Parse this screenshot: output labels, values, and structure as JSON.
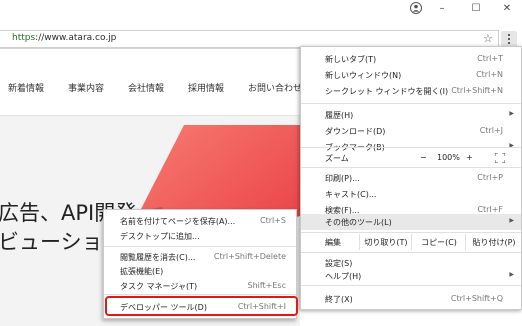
{
  "window": {
    "minimize_icon": "minimize-icon",
    "maximize_icon": "maximize-icon",
    "close_icon": "close-icon"
  },
  "omnibox": {
    "scheme": "https",
    "rest": "://www.atara.co.jp"
  },
  "site": {
    "nav": [
      "新着情報",
      "事業内容",
      "会社情報",
      "採用情報",
      "お問い合わせ"
    ],
    "hero_line1": "広告、API開発",
    "hero_line2": "ビューション",
    "accent_color": "#f2585a"
  },
  "menu": {
    "items": [
      {
        "label": "新しいタブ(T)",
        "shortcut": "Ctrl+T"
      },
      {
        "label": "新しいウィンドウ(N)",
        "shortcut": "Ctrl+N"
      },
      {
        "label": "シークレット ウィンドウを開く(I)",
        "shortcut": "Ctrl+Shift+N"
      },
      {
        "label": "履歴(H)",
        "submenu": true
      },
      {
        "label": "ダウンロード(D)",
        "shortcut": "Ctrl+J"
      },
      {
        "label": "ブックマーク(B)",
        "submenu": true
      },
      {
        "label": "印刷(P)...",
        "shortcut": "Ctrl+P"
      },
      {
        "label": "キャスト(C)..."
      },
      {
        "label": "検索(F)...",
        "shortcut": "Ctrl+F"
      },
      {
        "label": "その他のツール(L)",
        "submenu": true
      },
      {
        "label": "設定(S)"
      },
      {
        "label": "ヘルプ(H)",
        "submenu": true
      },
      {
        "label": "終了(X)",
        "shortcut": "Ctrl+Shift+Q"
      }
    ],
    "zoom": {
      "label": "ズーム",
      "minus": "−",
      "value": "100%",
      "plus": "+",
      "fullscreen_icon": "fullscreen-icon"
    },
    "edit": {
      "label": "編集",
      "cut": "切り取り(T)",
      "copy": "コピー(C)",
      "paste": "貼り付け(P)"
    }
  },
  "submenu": {
    "items": [
      {
        "label": "名前を付けてページを保存(A)...",
        "shortcut": "Ctrl+S"
      },
      {
        "label": "デスクトップに追加..."
      },
      {
        "label": "閲覧履歴を消去(C)...",
        "shortcut": "Ctrl+Shift+Delete"
      },
      {
        "label": "拡張機能(E)"
      },
      {
        "label": "タスク マネージャ(T)",
        "shortcut": "Shift+Esc"
      },
      {
        "label": "デベロッパー ツール(D)",
        "shortcut": "Ctrl+Shift+I"
      }
    ]
  },
  "annotation_color": "#e01818"
}
